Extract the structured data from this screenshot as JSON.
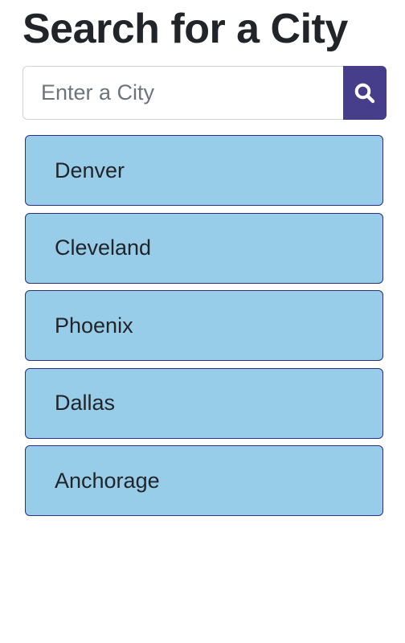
{
  "header": {
    "title": "Search for a City"
  },
  "search": {
    "placeholder": "Enter a City",
    "value": "",
    "button_icon": "search-icon"
  },
  "cities": [
    {
      "label": "Denver"
    },
    {
      "label": "Cleveland"
    },
    {
      "label": "Phoenix"
    },
    {
      "label": "Dallas"
    },
    {
      "label": "Anchorage"
    }
  ],
  "colors": {
    "accent": "#463d8b",
    "item_background": "#97cde9",
    "item_border": "#2c2f82",
    "text": "#212529"
  }
}
